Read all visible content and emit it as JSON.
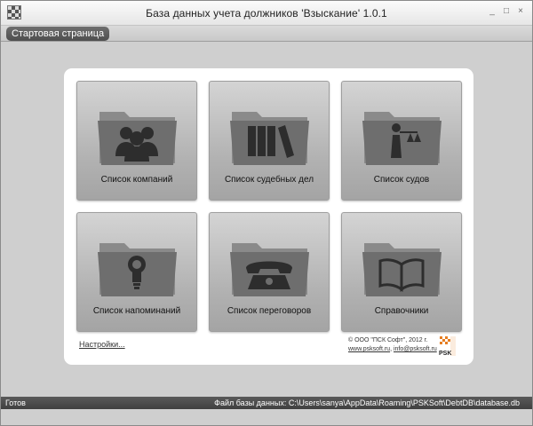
{
  "window": {
    "title": "База данных учета должников 'Взыскание' 1.0.1",
    "controls": {
      "minimize": "_",
      "maximize": "□",
      "close": "×"
    }
  },
  "tabs": [
    {
      "label": "Стартовая страница",
      "active": true
    }
  ],
  "tiles": [
    {
      "label": "Список компаний",
      "icon": "people-icon"
    },
    {
      "label": "Список судебных дел",
      "icon": "books-icon"
    },
    {
      "label": "Список судов",
      "icon": "justice-icon"
    },
    {
      "label": "Список напоминаний",
      "icon": "lightbulb-icon"
    },
    {
      "label": "Список переговоров",
      "icon": "phone-icon"
    },
    {
      "label": "Справочники",
      "icon": "open-book-icon"
    }
  ],
  "footer": {
    "settings_link": "Настройки...",
    "copyright": "© ООО \"ПСК Софт\", 2012 г.",
    "site_link": "www.psksoft.ru",
    "separator": ",",
    "email_link": "info@psksoft.ru",
    "logo_text": "PSK"
  },
  "status": {
    "left": "Готов",
    "right": "Файл базы данных: C:\\Users\\sanya\\AppData\\Roaming\\PSKSoft\\DebtDB\\database.db"
  },
  "colors": {
    "statusbar": "#4a4a4a",
    "tab_active": "#5a5a5a",
    "tile": "#bcbcbc",
    "folder": "#6e6e6e"
  }
}
